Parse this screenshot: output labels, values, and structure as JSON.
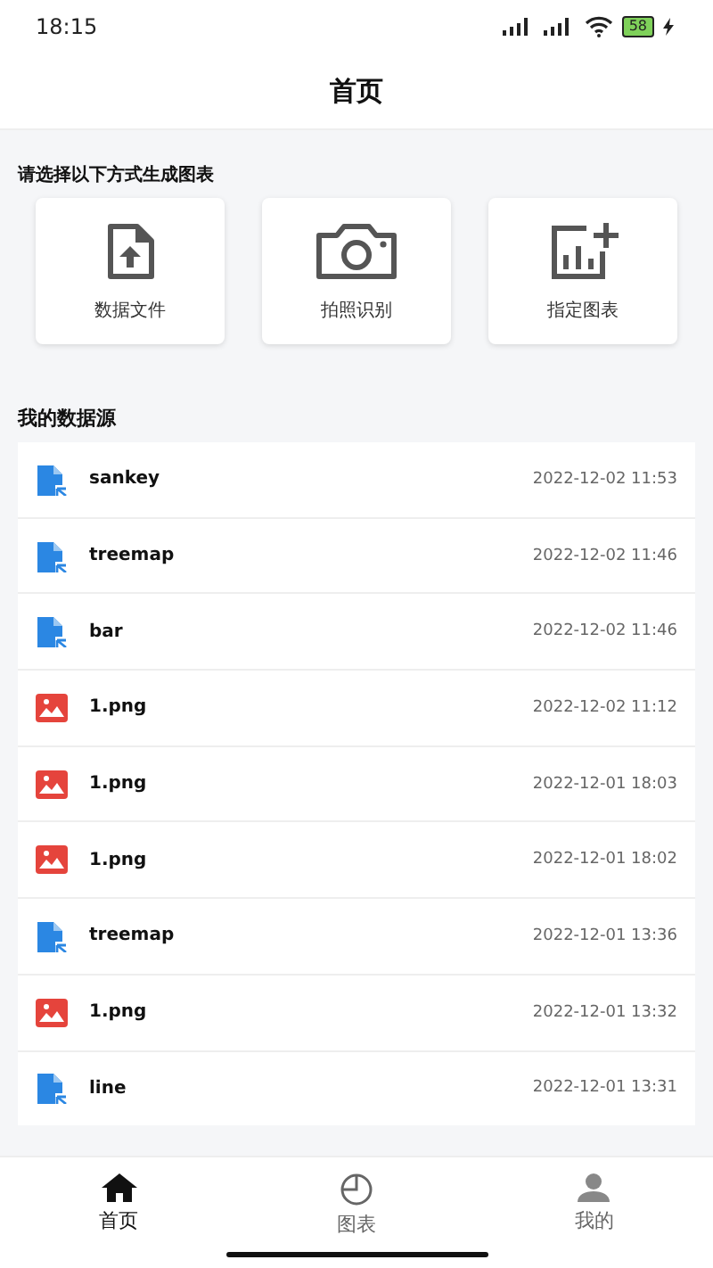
{
  "status_bar": {
    "time": "18:15",
    "battery": "58"
  },
  "header": {
    "title": "首页"
  },
  "create": {
    "prompt": "请选择以下方式生成图表",
    "options": [
      {
        "kind": "file",
        "label": "数据文件"
      },
      {
        "kind": "camera",
        "label": "拍照识别"
      },
      {
        "kind": "chart",
        "label": "指定图表"
      }
    ]
  },
  "sources": {
    "title": "我的数据源",
    "items": [
      {
        "kind": "data",
        "name": "sankey",
        "time": "2022-12-02 11:53"
      },
      {
        "kind": "data",
        "name": "treemap",
        "time": "2022-12-02 11:46"
      },
      {
        "kind": "data",
        "name": "bar",
        "time": "2022-12-02 11:46"
      },
      {
        "kind": "image",
        "name": "1.png",
        "time": "2022-12-02 11:12"
      },
      {
        "kind": "image",
        "name": "1.png",
        "time": "2022-12-01 18:03"
      },
      {
        "kind": "image",
        "name": "1.png",
        "time": "2022-12-01 18:02"
      },
      {
        "kind": "data",
        "name": "treemap",
        "time": "2022-12-01 13:36"
      },
      {
        "kind": "image",
        "name": "1.png",
        "time": "2022-12-01 13:32"
      },
      {
        "kind": "data",
        "name": "line",
        "time": "2022-12-01 13:31"
      }
    ]
  },
  "tabs": [
    {
      "kind": "home",
      "label": "首页",
      "selected": true
    },
    {
      "kind": "chart",
      "label": "图表",
      "selected": false
    },
    {
      "kind": "me",
      "label": "我的",
      "selected": false
    }
  ]
}
